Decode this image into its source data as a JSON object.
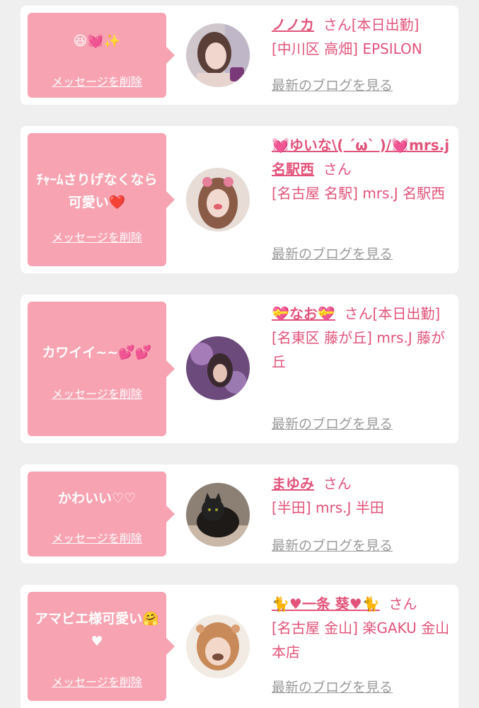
{
  "colors": {
    "background": "#efefef",
    "card": "#ffffff",
    "bubble": "#f7a3b2",
    "accent": "#e2537a",
    "link_gray": "#9a9a9a"
  },
  "common": {
    "delete_label": "メッセージを削除",
    "blog_label": "最新のブログを見る",
    "san_label": "さん"
  },
  "messages": [
    {
      "text": "😆💓✨",
      "name": "ノノカ",
      "suffix": "さん[本日出勤]",
      "shop": "[中川区 高畑] EPSILON",
      "avatar_icon": "portrait-photo"
    },
    {
      "text": "ﾁｬｰﾑさりげなくなら可愛い❤️",
      "name": "💓ゆいな\\( ´ω` )/💓mrs.j名駅西",
      "suffix": "さん",
      "shop": "[名古屋 名駅] mrs.J 名駅西",
      "avatar_icon": "portrait-photo"
    },
    {
      "text": "カワイイ~~💕💕",
      "name": "💝なお💝",
      "suffix": "さん[本日出勤]",
      "shop": "[名東区 藤が丘] mrs.J 藤が丘",
      "avatar_icon": "portrait-photo"
    },
    {
      "text": "かわいい♡♡",
      "name": "まゆみ",
      "suffix": "さん",
      "shop": "[半田] mrs.J 半田",
      "avatar_icon": "cat-photo"
    },
    {
      "text": "アマビエ様可愛い🤗♥",
      "name": "🐈♥一条 葵♥🐈",
      "suffix": "さん",
      "shop": "[名古屋 金山] 楽GAKU 金山本店",
      "avatar_icon": "portrait-photo"
    }
  ]
}
